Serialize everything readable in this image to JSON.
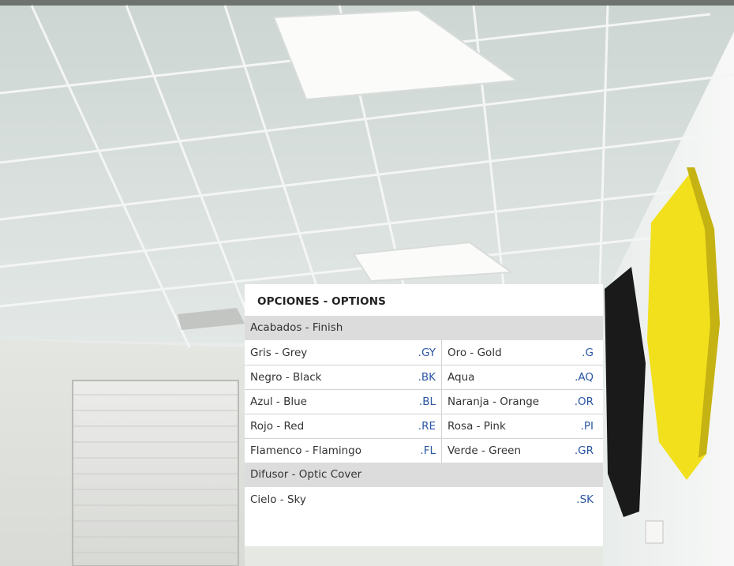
{
  "title": "OPCIONES - OPTIONS",
  "sections": [
    {
      "heading": "Acabados - Finish",
      "rows": [
        {
          "left": {
            "name": "Gris - Grey",
            "code": ".GY"
          },
          "right": {
            "name": "Oro - Gold",
            "code": ".G"
          }
        },
        {
          "left": {
            "name": "Negro - Black",
            "code": ".BK"
          },
          "right": {
            "name": "Aqua",
            "code": ".AQ"
          }
        },
        {
          "left": {
            "name": "Azul - Blue",
            "code": ".BL"
          },
          "right": {
            "name": "Naranja - Orange",
            "code": ".OR"
          }
        },
        {
          "left": {
            "name": "Rojo - Red",
            "code": ".RE"
          },
          "right": {
            "name": "Rosa - Pink",
            "code": ".PI"
          }
        },
        {
          "left": {
            "name": "Flamenco - Flamingo",
            "code": ".FL"
          },
          "right": {
            "name": "Verde - Green",
            "code": ".GR"
          }
        }
      ]
    },
    {
      "heading": "Difusor - Optic Cover",
      "rows": [
        {
          "full": {
            "name": "Cielo - Sky",
            "code": ".SK"
          }
        }
      ]
    }
  ],
  "colors": {
    "code_text": "#2a55a3",
    "section_bg": "#dcdcdc",
    "panel_yellow": "#f2e01c",
    "panel_black": "#1a1a1a"
  }
}
